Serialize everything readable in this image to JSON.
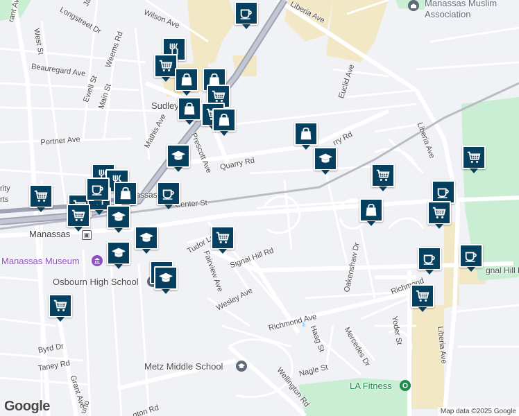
{
  "map": {
    "streets": {
      "liberia_ave_top": "Liberia Ave",
      "wilson_ave": "Wilson Ave",
      "longstreet_dr": "Longstreet Dr",
      "jackson": "Jack",
      "west_st": "West St",
      "weems_rd": "Weems Rd",
      "beauregard_ave": "Beauregard Ave",
      "ewell_st": "Ewell St",
      "main_st": "Main St",
      "sudley": "Sudley",
      "mathis_ave": "Mathis Ave",
      "prescott_ave": "Prescott Ave",
      "portner_ave": "Portner Ave",
      "quarry_rd_west": "Quarry Rd",
      "quarry_rd_east": "rry Rd",
      "euclid_ave": "Euclid Ave",
      "liberia_ave_right": "Liberia Ave",
      "center_st": "Center St",
      "tudor_ln": "Tudor Ln",
      "fairview_ave": "Fairview Ave",
      "signal_hill_rd": "Signal Hill Rd",
      "signal_hill_rd_east": "gnal Hill R",
      "oakenshaw_dr": "Oakenshaw Dr",
      "richmond_ave": "Richmond Ave",
      "richmond_east": "Richmond",
      "wesley_ave": "Wesley Ave",
      "haag_st": "Haag St",
      "mercedes_dr": "Mercedes Dr",
      "yoder_st": "Yoder St",
      "liberia_ave_bottom": "Liberia Ave",
      "byrd_dr": "Byrd Dr",
      "taney_rd": "Taney Rd",
      "grant_ave": "Grant Ave",
      "grant_ave_top": "rant Ave",
      "wellington_rd": "Wellington Rd",
      "wellington_rd_west": "gton Rd",
      "nagle_st": "Nagle St",
      "burton": "urto",
      "rity": "rity",
      "rts": "rts"
    },
    "places": {
      "manassas": "Manassas",
      "manassas_partial": "anassas",
      "manassas_museum": "Manassas Museum",
      "osbourn_high_school": "Osbourn High School",
      "metz_middle_school": "Metz Middle School",
      "la_fitness": "LA Fitness",
      "muslim_association_line1": "Manassas Muslim",
      "muslim_association_line2": "Association"
    },
    "markers": [
      {
        "type": "cafe-icon"
      },
      {
        "type": "restaurant-icon"
      },
      {
        "type": "grocery-cart-icon"
      },
      {
        "type": "shopping-bag-icon"
      },
      {
        "type": "shopping-bag-icon"
      },
      {
        "type": "grocery-cart-icon"
      },
      {
        "type": "shopping-bag-icon"
      },
      {
        "type": "grocery-cart-icon"
      },
      {
        "type": "shopping-bag-icon"
      },
      {
        "type": "shopping-bag-icon"
      },
      {
        "type": "school-cap-icon"
      },
      {
        "type": "school-cap-icon"
      },
      {
        "type": "grocery-cart-icon"
      },
      {
        "type": "grocery-cart-icon"
      },
      {
        "type": "cafe-icon"
      },
      {
        "type": "shopping-bag-icon"
      },
      {
        "type": "cafe-icon"
      },
      {
        "type": "grocery-cart-icon"
      },
      {
        "type": "cafe-icon"
      },
      {
        "type": "cafe-icon"
      },
      {
        "type": "grocery-cart-icon"
      },
      {
        "type": "grocery-cart-icon"
      },
      {
        "type": "restaurant-icon"
      },
      {
        "type": "restaurant-icon"
      },
      {
        "type": "shopping-bag-icon"
      },
      {
        "type": "grocery-cart-icon"
      },
      {
        "type": "restaurant-icon"
      },
      {
        "type": "cafe-icon"
      },
      {
        "type": "grocery-cart-icon"
      },
      {
        "type": "school-cap-icon"
      },
      {
        "type": "school-cap-icon"
      },
      {
        "type": "grocery-cart-icon"
      },
      {
        "type": "school-cap-icon"
      },
      {
        "type": "school-cap-icon"
      },
      {
        "type": "school-cap-icon"
      },
      {
        "type": "grocery-cart-icon"
      }
    ],
    "google_logo": "Google",
    "attribution": "Map data ©2025 Google",
    "colors": {
      "marker": "#07405f",
      "water": "#aadaff",
      "park": "#c9eed3",
      "commercial": "#f3e8c6",
      "highway": "#9ea4b3",
      "rail": "#b9bcc6"
    }
  }
}
